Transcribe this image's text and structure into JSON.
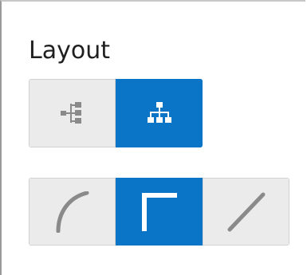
{
  "panel": {
    "title": "Layout"
  },
  "layout_options": {
    "items": [
      {
        "name": "tree-layout",
        "icon": "tree-layout-icon",
        "selected": false
      },
      {
        "name": "hierarchical-layout",
        "icon": "org-chart-icon",
        "selected": true
      }
    ]
  },
  "connector_options": {
    "items": [
      {
        "name": "curved-connector",
        "icon": "curved-line-icon",
        "selected": false
      },
      {
        "name": "orthogonal-connector",
        "icon": "right-angle-icon",
        "selected": true
      },
      {
        "name": "straight-connector",
        "icon": "straight-line-icon",
        "selected": false
      }
    ]
  },
  "colors": {
    "accent": "#0a74c6",
    "button_bg": "#ebebeb",
    "icon_gray": "#8a8a8a",
    "icon_white": "#ffffff"
  }
}
